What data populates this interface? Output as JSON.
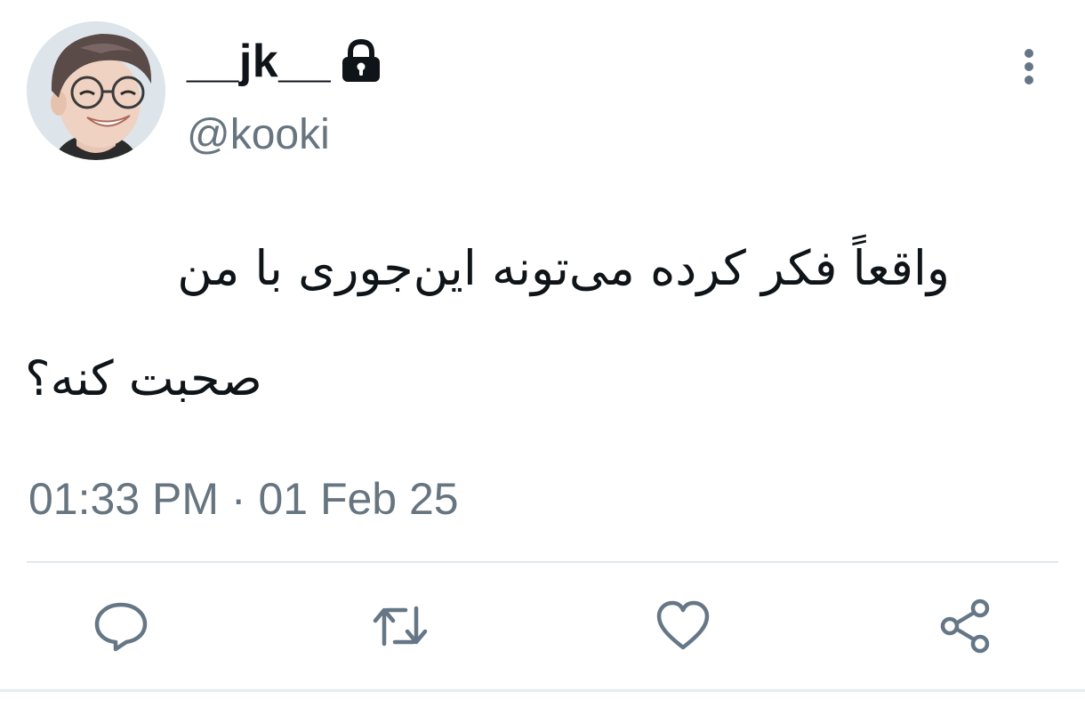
{
  "user": {
    "display_name": "__jk__",
    "handle": "@kooki",
    "avatar_icon": "profile-photo",
    "lock_icon": "lock-icon"
  },
  "tweet": {
    "text_line1": "واقعاً فکر کرده می‌تونه این‌جوری با من",
    "text_line2": "صحبت کنه؟",
    "timestamp": "01:33 PM · 01 Feb 25"
  },
  "actions": {
    "reply_icon": "reply-icon",
    "retweet_icon": "retweet-icon",
    "like_icon": "like-icon",
    "share_icon": "share-icon",
    "more_icon": "more-vertical-icon"
  },
  "colors": {
    "text": "#0f1419",
    "secondary": "#66757f",
    "divider": "#e1e8ed",
    "icon": "#657786"
  }
}
